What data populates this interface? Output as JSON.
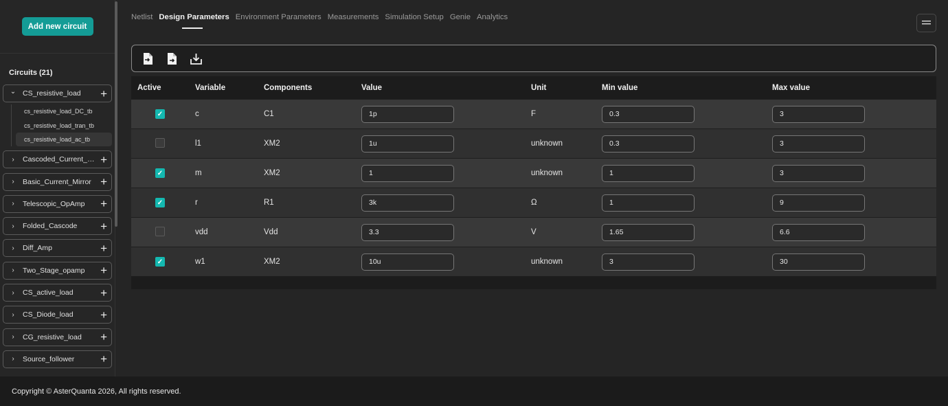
{
  "sidebar": {
    "add_button": "Add new circuit",
    "circuits_title": "Circuits (21)",
    "circuits": [
      {
        "name": "CS_resistive_load",
        "expanded": true,
        "children": [
          "cs_resistive_load_DC_tb",
          "cs_resistive_load_tran_tb",
          "cs_resistive_load_ac_tb"
        ],
        "active_child": 2
      },
      {
        "name": "Cascoded_Current_M..."
      },
      {
        "name": "Basic_Current_Mirror"
      },
      {
        "name": "Telescopic_OpAmp"
      },
      {
        "name": "Folded_Cascode"
      },
      {
        "name": "Diff_Amp"
      },
      {
        "name": "Two_Stage_opamp"
      },
      {
        "name": "CS_active_load"
      },
      {
        "name": "CS_Diode_load"
      },
      {
        "name": "CG_resistive_load"
      },
      {
        "name": "Source_follower"
      }
    ]
  },
  "tabs": [
    "Netlist",
    "Design Parameters",
    "Environment Parameters",
    "Measurements",
    "Simulation Setup",
    "Genie",
    "Analytics"
  ],
  "active_tab": "Design Parameters",
  "toolbar_icons": [
    "import-file-icon",
    "export-file-icon",
    "download-icon"
  ],
  "table": {
    "headers": {
      "active": "Active",
      "variable": "Variable",
      "components": "Components",
      "value": "Value",
      "unit": "Unit",
      "min": "Min value",
      "max": "Max value"
    },
    "rows": [
      {
        "active": true,
        "variable": "c",
        "component": "C1",
        "value": "1p",
        "unit": "F",
        "min": "0.3",
        "max": "3"
      },
      {
        "active": false,
        "variable": "l1",
        "component": "XM2",
        "value": "1u",
        "unit": "unknown",
        "min": "0.3",
        "max": "3"
      },
      {
        "active": true,
        "variable": "m",
        "component": "XM2",
        "value": "1",
        "unit": "unknown",
        "min": "1",
        "max": "3"
      },
      {
        "active": true,
        "variable": "r",
        "component": "R1",
        "value": "3k",
        "unit": "Ω",
        "min": "1",
        "max": "9"
      },
      {
        "active": false,
        "variable": "vdd",
        "component": "Vdd",
        "value": "3.3",
        "unit": "V",
        "min": "1.65",
        "max": "6.6"
      },
      {
        "active": true,
        "variable": "w1",
        "component": "XM2",
        "value": "10u",
        "unit": "unknown",
        "min": "3",
        "max": "30"
      }
    ]
  },
  "footer": {
    "copyright": "Copyright © AsterQuanta 2026, All rights reserved."
  },
  "colors": {
    "accent": "#149c96",
    "checkbox_on": "#14b8b0"
  }
}
